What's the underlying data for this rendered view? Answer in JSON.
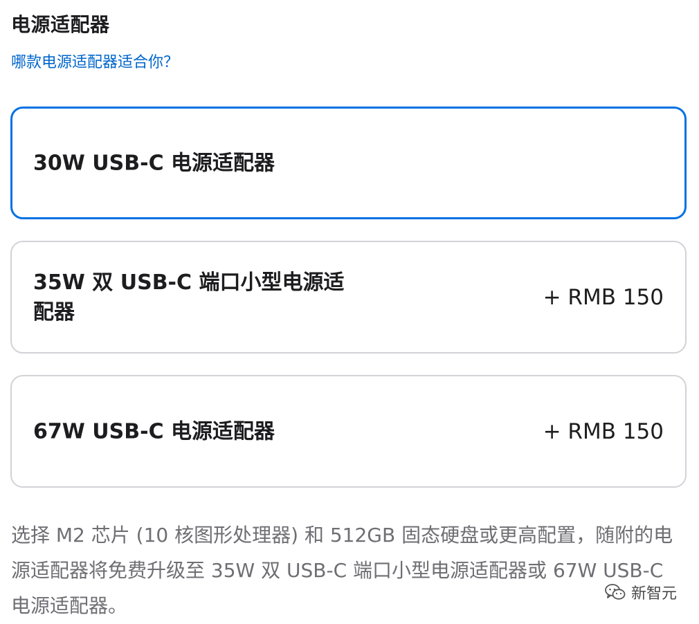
{
  "section": {
    "title": "电源适配器",
    "help_link": "哪款电源适配器适合你？"
  },
  "options": [
    {
      "name": "30W USB-C 电源适配器",
      "price": "",
      "selected": true
    },
    {
      "name": "35W 双 USB-C 端口小型电源适配器",
      "price": "+ RMB 150",
      "selected": false
    },
    {
      "name": "67W USB-C 电源适配器",
      "price": "+ RMB 150",
      "selected": false
    }
  ],
  "footnote": "选择 M2 芯片 (10 核图形处理器) 和 512GB 固态硬盘或更高配置，随附的电源适配器将免费升级至 35W 双 USB-C 端口小型电源适配器或 67W USB-C 电源适配器。",
  "watermark": {
    "text": "新智元",
    "icon": "wechat-icon"
  },
  "colors": {
    "accent": "#0071e3",
    "link": "#0066cc",
    "border": "#d2d2d7",
    "text": "#1d1d1f",
    "secondary_text": "#6e6e73"
  }
}
